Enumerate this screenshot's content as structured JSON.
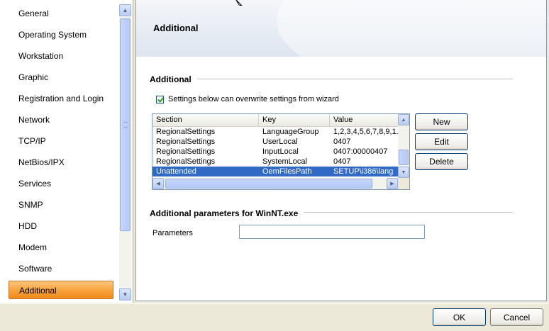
{
  "nav": {
    "items": [
      {
        "label": "General"
      },
      {
        "label": "Operating System"
      },
      {
        "label": "Workstation"
      },
      {
        "label": "Graphic"
      },
      {
        "label": "Registration and Login"
      },
      {
        "label": "Network"
      },
      {
        "label": "TCP/IP"
      },
      {
        "label": "NetBios/IPX"
      },
      {
        "label": "Services"
      },
      {
        "label": "SNMP"
      },
      {
        "label": "HDD"
      },
      {
        "label": "Modem"
      },
      {
        "label": "Software"
      },
      {
        "label": "Additional"
      }
    ],
    "selected": "Additional"
  },
  "banner": {
    "title": "Additional"
  },
  "group1": {
    "title": "Additional",
    "checkbox": {
      "label": "Settings below can overwrite settings from wizard",
      "checked": true
    }
  },
  "list": {
    "columns": [
      "Section",
      "Key",
      "Value"
    ],
    "rows": [
      {
        "section": "RegionalSettings",
        "key": "LanguageGroup",
        "value": "1,2,3,4,5,6,7,8,9,1..."
      },
      {
        "section": "RegionalSettings",
        "key": "UserLocal",
        "value": "0407"
      },
      {
        "section": "RegionalSettings",
        "key": "InputLocal",
        "value": "0407:00000407"
      },
      {
        "section": "RegionalSettings",
        "key": "SystemLocal",
        "value": "0407"
      },
      {
        "section": "Unattended",
        "key": "OemFilesPath",
        "value": "SETUP\\i386\\lang",
        "selected": true
      }
    ]
  },
  "list_buttons": {
    "new": "New",
    "edit": "Edit",
    "delete": "Delete"
  },
  "group2": {
    "title": "Additional parameters for WinNT.exe",
    "param_label": "Parameters",
    "param_value": ""
  },
  "footer": {
    "ok": "OK",
    "cancel": "Cancel"
  },
  "colors": {
    "selected_nav": "#f7a13b",
    "selected_row": "#316ac5"
  }
}
